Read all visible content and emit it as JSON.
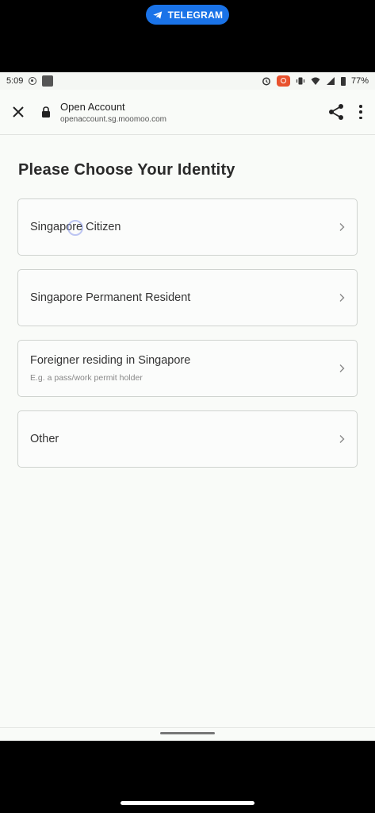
{
  "overlay": {
    "telegram_label": "TELEGRAM"
  },
  "statusbar": {
    "time": "5:09",
    "battery_text": "77%"
  },
  "browser": {
    "title": "Open Account",
    "url": "openaccount.sg.moomoo.com"
  },
  "page": {
    "title": "Please Choose Your Identity",
    "options": [
      {
        "label": "Singapore Citizen",
        "sub": ""
      },
      {
        "label": "Singapore Permanent Resident",
        "sub": ""
      },
      {
        "label": "Foreigner residing in Singapore",
        "sub": "E.g. a pass/work permit holder"
      },
      {
        "label": "Other",
        "sub": ""
      }
    ]
  },
  "colors": {
    "telegram_blue": "#1a73e8",
    "record_orange": "#e8512d"
  },
  "icons": [
    "telegram-icon",
    "close-icon",
    "lock-icon",
    "share-icon",
    "more-vert-icon",
    "chevron-right-icon"
  ]
}
